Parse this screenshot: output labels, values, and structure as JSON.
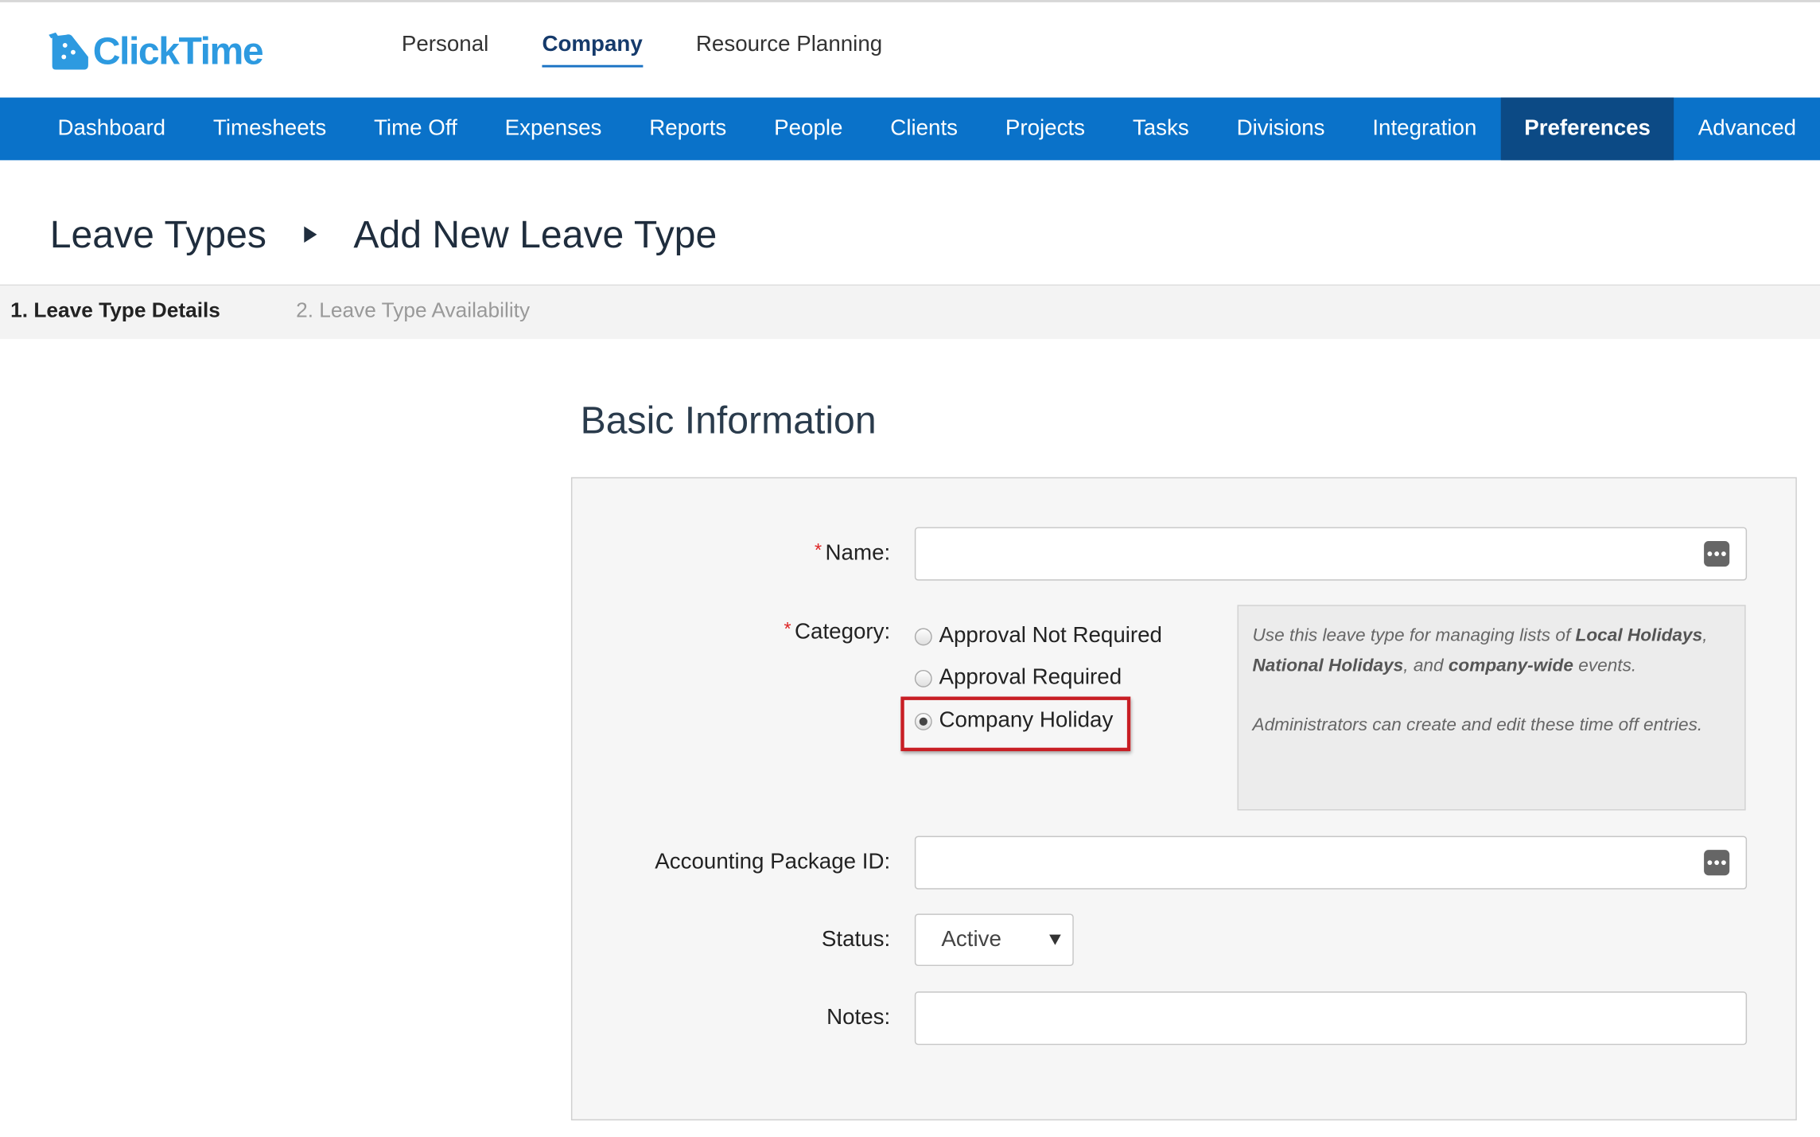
{
  "app": {
    "logo_text": "ClickTime"
  },
  "top_nav": [
    {
      "label": "Personal",
      "active": false
    },
    {
      "label": "Company",
      "active": true
    },
    {
      "label": "Resource Planning",
      "active": false
    }
  ],
  "main_nav": [
    {
      "label": "Dashboard"
    },
    {
      "label": "Timesheets"
    },
    {
      "label": "Time Off"
    },
    {
      "label": "Expenses"
    },
    {
      "label": "Reports"
    },
    {
      "label": "People"
    },
    {
      "label": "Clients"
    },
    {
      "label": "Projects"
    },
    {
      "label": "Tasks"
    },
    {
      "label": "Divisions"
    },
    {
      "label": "Integration"
    },
    {
      "label": "Preferences",
      "active": true
    },
    {
      "label": "Advanced"
    }
  ],
  "breadcrumb": {
    "parent": "Leave Types",
    "current": "Add New Leave Type"
  },
  "steps": {
    "step1": "1. Leave Type Details",
    "step2": "2. Leave Type Availability"
  },
  "form": {
    "section_title": "Basic Information",
    "required_mark": "*",
    "name_label": "Name:",
    "name_value": "",
    "category_label": "Category:",
    "category_options": [
      {
        "label": "Approval Not Required",
        "checked": false
      },
      {
        "label": "Approval Required",
        "checked": false
      },
      {
        "label": "Company Holiday",
        "checked": true
      }
    ],
    "help": {
      "line1_pre": "Use this leave type for managing lists of ",
      "line1_b1": "Local Holidays",
      "line1_sep": ",",
      "line2_b2": "National Holidays",
      "line2_mid": ", and ",
      "line2_b3": "company-wide",
      "line2_post": " events.",
      "line3": "Administrators can create and edit these time off entries."
    },
    "accounting_label": "Accounting Package ID:",
    "accounting_value": "",
    "status_label": "Status:",
    "status_value": "Active",
    "notes_label": "Notes:",
    "notes_value": ""
  },
  "colors": {
    "nav_blue": "#0a72c9",
    "nav_active": "#0c4a85",
    "logo_blue": "#2d9ae0",
    "highlight_red": "#c81e24"
  }
}
